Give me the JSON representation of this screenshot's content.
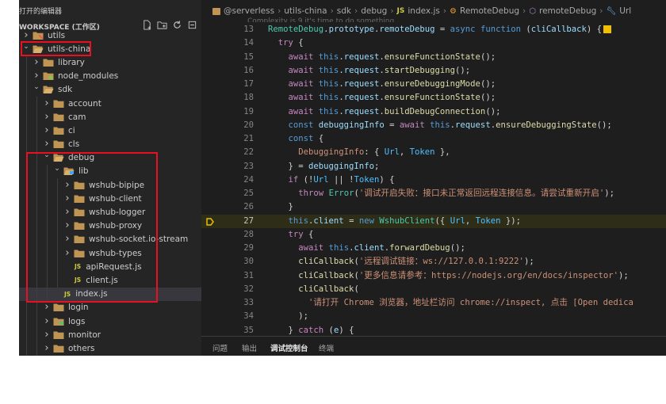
{
  "sidebar": {
    "title": "打开的编辑器",
    "workspace_label": "WORKSPACE (工作区)",
    "actions": [
      "new-file-icon",
      "new-folder-icon",
      "refresh-icon",
      "collapse-all-icon"
    ],
    "tree": [
      {
        "label": "utils",
        "depth": 0,
        "kind": "folder",
        "open": false,
        "icon": "tools-folder-icon"
      },
      {
        "label": "utils-china",
        "depth": 0,
        "kind": "folder",
        "open": true,
        "icon": "folder-open-icon"
      },
      {
        "label": "library",
        "depth": 1,
        "kind": "folder",
        "open": false,
        "icon": "folder-icon"
      },
      {
        "label": "node_modules",
        "depth": 1,
        "kind": "folder",
        "open": false,
        "icon": "node-folder-icon"
      },
      {
        "label": "sdk",
        "depth": 1,
        "kind": "folder",
        "open": true,
        "icon": "folder-open-icon"
      },
      {
        "label": "account",
        "depth": 2,
        "kind": "folder",
        "open": false,
        "icon": "folder-icon"
      },
      {
        "label": "cam",
        "depth": 2,
        "kind": "folder",
        "open": false,
        "icon": "folder-icon"
      },
      {
        "label": "ci",
        "depth": 2,
        "kind": "folder",
        "open": false,
        "icon": "folder-icon"
      },
      {
        "label": "cls",
        "depth": 2,
        "kind": "folder",
        "open": false,
        "icon": "folder-icon"
      },
      {
        "label": "debug",
        "depth": 2,
        "kind": "folder",
        "open": true,
        "icon": "folder-open-icon"
      },
      {
        "label": "lib",
        "depth": 3,
        "kind": "folder",
        "open": true,
        "icon": "lib-folder-icon"
      },
      {
        "label": "wshub-bipipe",
        "depth": 4,
        "kind": "folder",
        "open": false,
        "icon": "folder-icon"
      },
      {
        "label": "wshub-client",
        "depth": 4,
        "kind": "folder",
        "open": false,
        "icon": "folder-icon"
      },
      {
        "label": "wshub-logger",
        "depth": 4,
        "kind": "folder",
        "open": false,
        "icon": "folder-icon"
      },
      {
        "label": "wshub-proxy",
        "depth": 4,
        "kind": "folder",
        "open": false,
        "icon": "folder-icon"
      },
      {
        "label": "wshub-socket.io-stream",
        "depth": 4,
        "kind": "folder",
        "open": false,
        "icon": "folder-icon"
      },
      {
        "label": "wshub-types",
        "depth": 4,
        "kind": "folder",
        "open": false,
        "icon": "folder-icon"
      },
      {
        "label": "apiRequest.js",
        "depth": 4,
        "kind": "file",
        "badge": "JS"
      },
      {
        "label": "client.js",
        "depth": 4,
        "kind": "file",
        "badge": "JS"
      },
      {
        "label": "index.js",
        "depth": 3,
        "kind": "file",
        "badge": "JS",
        "selected": true
      },
      {
        "label": "login",
        "depth": 2,
        "kind": "folder",
        "open": false,
        "icon": "folder-icon"
      },
      {
        "label": "logs",
        "depth": 2,
        "kind": "folder",
        "open": false,
        "icon": "logs-folder-icon"
      },
      {
        "label": "monitor",
        "depth": 2,
        "kind": "folder",
        "open": false,
        "icon": "folder-icon"
      },
      {
        "label": "others",
        "depth": 2,
        "kind": "folder",
        "open": false,
        "icon": "folder-icon"
      }
    ]
  },
  "breadcrumb": {
    "items": [
      "@serverless",
      "utils-china",
      "sdk",
      "debug",
      "index.js",
      "RemoteDebug",
      "remoteDebug",
      "Url"
    ],
    "js_badge": "JS"
  },
  "editor": {
    "hint_text": "Complexity is 9 it's time to do something...",
    "current_line": 27,
    "lines": [
      {
        "n": 13,
        "t": "RemoteDebug.prototype.remoteDebug = async function (cliCallback) {"
      },
      {
        "n": 14,
        "t": "  try {"
      },
      {
        "n": 15,
        "t": "    await this.request.ensureFunctionState();"
      },
      {
        "n": 16,
        "t": "    await this.request.startDebugging();"
      },
      {
        "n": 17,
        "t": "    await this.request.ensureDebuggingMode();"
      },
      {
        "n": 18,
        "t": "    await this.request.ensureFunctionState();"
      },
      {
        "n": 19,
        "t": "    await this.request.buildDebugConnection();"
      },
      {
        "n": 20,
        "t": "    const debuggingInfo = await this.request.ensureDebuggingState();"
      },
      {
        "n": 21,
        "t": "    const {"
      },
      {
        "n": 22,
        "t": "      DebuggingInfo: { Url, Token },"
      },
      {
        "n": 23,
        "t": "    } = debuggingInfo;"
      },
      {
        "n": 24,
        "t": "    if (!Url || !Token) {"
      },
      {
        "n": 25,
        "t": "      throw Error('调试开启失败：接口未正常返回远程连接信息。请尝试重新开启');"
      },
      {
        "n": 26,
        "t": "    }"
      },
      {
        "n": 27,
        "t": "    this.client = new WshubClient({ Url, Token });"
      },
      {
        "n": 28,
        "t": "    try {"
      },
      {
        "n": 29,
        "t": "      await this.client.forwardDebug();"
      },
      {
        "n": 30,
        "t": "      cliCallback('远程调试链接：ws://127.0.0.1:9222');"
      },
      {
        "n": 31,
        "t": "      cliCallback('更多信息请参考：https://nodejs.org/en/docs/inspector');"
      },
      {
        "n": 32,
        "t": "      cliCallback("
      },
      {
        "n": 33,
        "t": "        '请打开 Chrome 浏览器，地址栏访问 chrome://inspect, 点击 [Open dedica"
      },
      {
        "n": 34,
        "t": "      );"
      },
      {
        "n": 35,
        "t": "    } catch (e) {"
      }
    ]
  },
  "panel": {
    "tabs": [
      "问题",
      "输出",
      "调试控制台",
      "终端"
    ],
    "active_tab": "调试控制台"
  },
  "colors": {
    "highlight_box": "#e81123",
    "folder": "#c09553",
    "js_badge": "#cbcb41",
    "breakpoint": "#e5c000"
  }
}
